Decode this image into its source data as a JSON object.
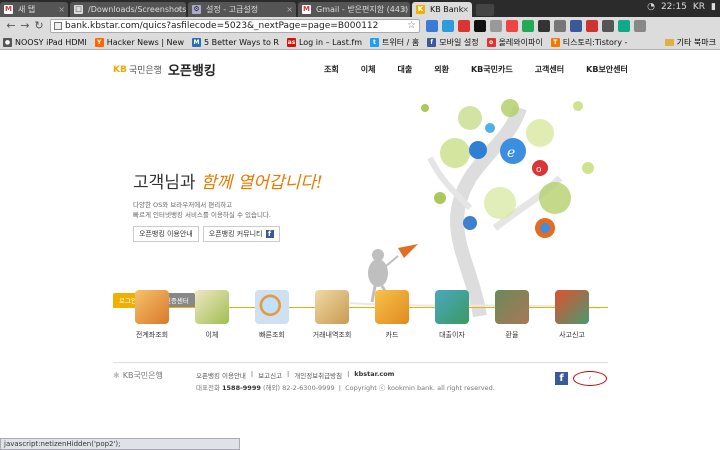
{
  "browser": {
    "tabs": [
      {
        "label": "새 탭",
        "icon": "gmail-icon",
        "active": false
      },
      {
        "label": "/Downloads/Screenshots",
        "icon": "file-icon",
        "active": false
      },
      {
        "label": "설정 - 고급설정",
        "icon": "settings-icon",
        "active": false
      },
      {
        "label": "Gmail - 받은편지함 (443)",
        "icon": "gmail-icon",
        "active": false
      },
      {
        "label": "KB Bank",
        "icon": "kb-icon",
        "active": true
      }
    ],
    "url": "bank.kbstar.com/quics?asfilecode=5023&_nextPage=page=B000112",
    "clock": "22:15",
    "lang": "KR",
    "bookmarks": [
      {
        "label": "NOOSY iPad HDMI",
        "color": "#555"
      },
      {
        "label": "Hacker News | New",
        "color": "#ff6600"
      },
      {
        "label": "5 Better Ways to R",
        "color": "#2a6ebb"
      },
      {
        "label": "Log in – Last.fm",
        "color": "#d51007"
      },
      {
        "label": "트위터 / 홈",
        "color": "#1da1f2"
      },
      {
        "label": "모바일 설정",
        "color": "#3b5998"
      },
      {
        "label": "올레와이파이",
        "color": "#d33"
      },
      {
        "label": "티스토리:Tistory - ",
        "color": "#ee7a00"
      }
    ],
    "other_bookmarks": "기타 북마크",
    "status": "javascript:netizenHidden('pop2');"
  },
  "site": {
    "kb_mark": "KB",
    "kb_name": "국민은행",
    "service": "오픈뱅킹",
    "gnb": [
      "조회",
      "이체",
      "대출",
      "외환",
      "KB국민카드",
      "고객센터",
      "KB보안센터"
    ],
    "headline_plain": "고객님과 ",
    "headline_accent": "함께 열어갑니다!",
    "desc_line1": "다양한 OS와 브라우저에서 편리하고",
    "desc_line2": "빠르게 인터넷뱅킹 서비스를 이용하실 수 있습니다.",
    "btn_guide": "오픈뱅킹 이용안내",
    "btn_community": "오픈뱅킹 커뮤니티",
    "tab_login": "로그인",
    "tab_cert": "공인인증센터",
    "quick": [
      {
        "label": "전계좌조회",
        "color": "#e8a040"
      },
      {
        "label": "이체",
        "color": "#9fbf50"
      },
      {
        "label": "빠른조회",
        "color": "#7aa0d0"
      },
      {
        "label": "거래내역조회",
        "color": "#d4b070"
      },
      {
        "label": "카드",
        "color": "#e0a030"
      },
      {
        "label": "대출이자",
        "color": "#5aa0b8"
      },
      {
        "label": "환율",
        "color": "#9a7860"
      },
      {
        "label": "사고신고",
        "color": "#58a060"
      }
    ],
    "footer_logo": "KB국민은행",
    "footer_links": [
      "오픈뱅킹 이용안내",
      "보고신고",
      "개인정보취급방침",
      "kbstar.com"
    ],
    "footer_tel_label": "대표전화",
    "footer_tel": "1588-9999",
    "footer_tel_overseas": "(해외) 82-2-6300-9999",
    "footer_copy": "Copyright ⓒ kookmin bank. all right reserved."
  }
}
